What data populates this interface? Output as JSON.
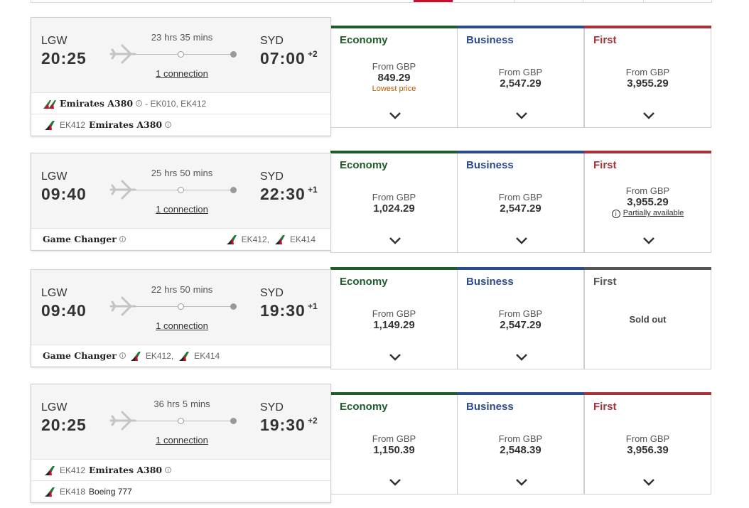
{
  "colors": {
    "economy": "#1e5c2a",
    "business": "#2c4a8c",
    "first": "#a8323a",
    "sold_out": "#555555",
    "tab_active": "#c8102e"
  },
  "cabin_labels": {
    "economy": "Economy",
    "business": "Business",
    "first": "First"
  },
  "from_label": "From GBP",
  "flights": [
    {
      "dep": {
        "code": "LGW",
        "time": "20:25"
      },
      "arr": {
        "code": "SYD",
        "time": "07:00",
        "day_offset": "+2"
      },
      "duration": {
        "hours": "23",
        "h_unit": "hrs",
        "mins": "35",
        "m_unit": "mins"
      },
      "connections": "1 connection",
      "segments": [
        {
          "tail": "emirates-tail-double",
          "name": "Emirates A380",
          "detail": "- EK010, EK412"
        },
        {
          "code": "EK412",
          "name": "Emirates A380"
        }
      ],
      "fares": {
        "economy": {
          "price": "849.29",
          "note": "Lowest price"
        },
        "business": {
          "price": "2,547.29"
        },
        "first": {
          "price": "3,955.29"
        }
      }
    },
    {
      "dep": {
        "code": "LGW",
        "time": "09:40"
      },
      "arr": {
        "code": "SYD",
        "time": "22:30",
        "day_offset": "+1"
      },
      "duration": {
        "hours": "25",
        "h_unit": "hrs",
        "mins": "50",
        "m_unit": "mins"
      },
      "connections": "1 connection",
      "segments": [
        {
          "name": "Game Changer",
          "codes": [
            "EK412,",
            "EK414"
          ]
        }
      ],
      "fares": {
        "economy": {
          "price": "1,024.29"
        },
        "business": {
          "price": "2,547.29"
        },
        "first": {
          "price": "3,955.29",
          "partial": "Partially available"
        }
      }
    },
    {
      "dep": {
        "code": "LGW",
        "time": "09:40"
      },
      "arr": {
        "code": "SYD",
        "time": "19:30",
        "day_offset": "+1"
      },
      "duration": {
        "hours": "22",
        "h_unit": "hrs",
        "mins": "50",
        "m_unit": "mins"
      },
      "connections": "1 connection",
      "segments": [
        {
          "name": "Game Changer",
          "codes": [
            "EK412,",
            "EK414"
          ]
        }
      ],
      "fares": {
        "economy": {
          "price": "1,149.29"
        },
        "business": {
          "price": "2,547.29"
        },
        "first": {
          "sold_out": "Sold out"
        }
      }
    },
    {
      "dep": {
        "code": "LGW",
        "time": "20:25"
      },
      "arr": {
        "code": "SYD",
        "time": "19:30",
        "day_offset": "+2"
      },
      "duration": {
        "hours": "36",
        "h_unit": "hrs",
        "mins": "5",
        "m_unit": "mins"
      },
      "connections": "1 connection",
      "segments": [
        {
          "code": "EK412",
          "name": "Emirates A380"
        },
        {
          "code": "EK418",
          "name": "Boeing 777"
        }
      ],
      "fares": {
        "economy": {
          "price": "1,150.39"
        },
        "business": {
          "price": "2,548.39"
        },
        "first": {
          "price": "3,956.39"
        }
      }
    }
  ]
}
